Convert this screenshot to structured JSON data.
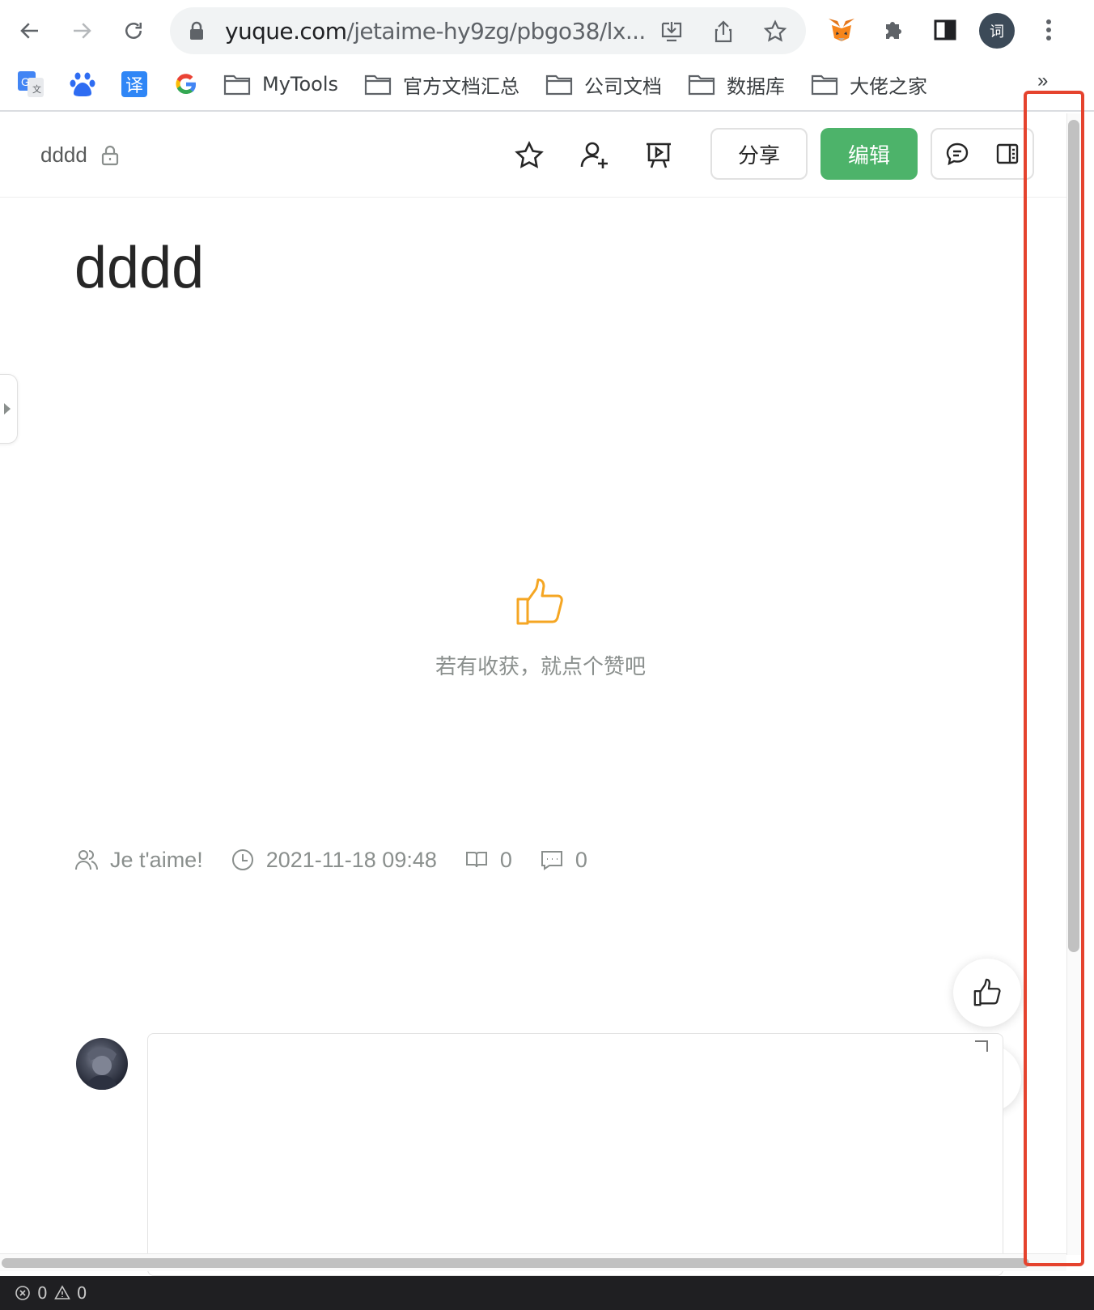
{
  "browser": {
    "url_host": "yuque.com",
    "url_path": "/jetaime-hy9zg/pbgo38/lx...",
    "profile_initial": "词"
  },
  "bookmarks": {
    "folders": [
      "MyTools",
      "官方文档汇总",
      "公司文档",
      "数据库",
      "大佬之家"
    ],
    "more": "»"
  },
  "doc_header": {
    "breadcrumb": "dddd",
    "share_label": "分享",
    "edit_label": "编辑"
  },
  "document": {
    "title": "dddd",
    "like_hint": "若有收获，就点个赞吧"
  },
  "meta": {
    "author": "Je t'aime!",
    "timestamp": "2021-11-18 09:48",
    "reads": "0",
    "comments": "0"
  },
  "status_bar": {
    "errors": "0",
    "warnings": "0"
  },
  "colors": {
    "edit_button": "#4db36a",
    "like_icon": "#f5a623",
    "highlight_box": "#e5432e"
  }
}
